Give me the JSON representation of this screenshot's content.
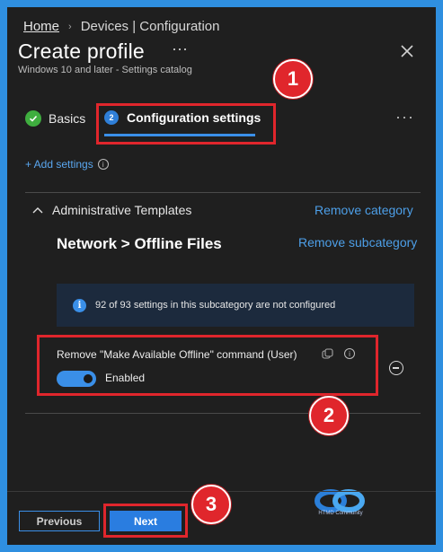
{
  "breadcrumb": {
    "home": "Home",
    "current": "Devices | Configuration"
  },
  "header": {
    "title": "Create profile",
    "more": "···",
    "subtitle": "Windows 10 and later - Settings catalog"
  },
  "tabs": [
    {
      "label": "Basics",
      "status": "complete"
    },
    {
      "label": "Configuration settings",
      "step": "2",
      "status": "active"
    }
  ],
  "tabs_more": "···",
  "add_settings": {
    "label": "+ Add settings",
    "info": "i"
  },
  "category": {
    "name": "Administrative Templates",
    "remove_label": "Remove category",
    "subcategory": "Network > Offline Files",
    "remove_sub_label": "Remove subcategory"
  },
  "info_banner": {
    "icon": "i",
    "text": "92 of 93 settings in this subcategory are not configured"
  },
  "setting": {
    "name": "Remove \"Make Available Offline\" command (User)",
    "info": "i",
    "toggle_state": "on",
    "toggle_label": "Enabled"
  },
  "footer": {
    "previous_label": "Previous",
    "next_label": "Next"
  },
  "callouts": [
    "1",
    "2",
    "3"
  ],
  "watermark": "HTMD Community",
  "colors": {
    "accent": "#3a8fe8",
    "callout": "#e0262c",
    "background": "#1f1f1f",
    "success": "#3fae3f"
  }
}
